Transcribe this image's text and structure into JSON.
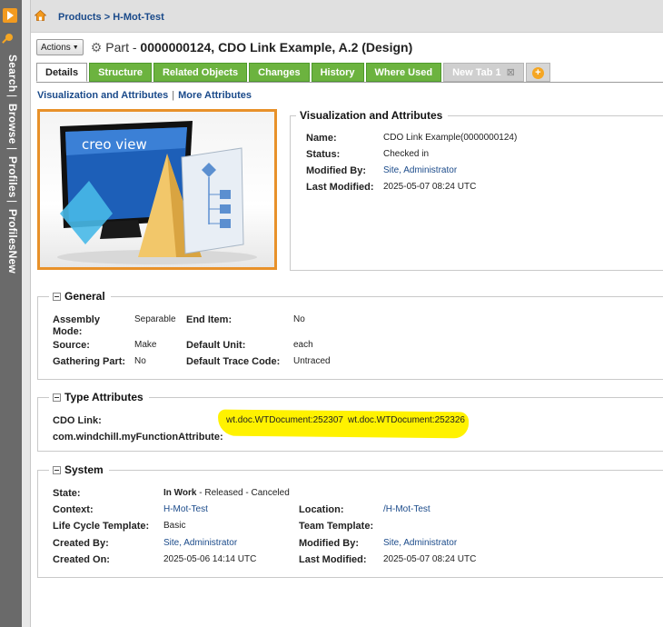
{
  "breadcrumb": "Products > H-Mot-Test",
  "left_nav": [
    "Search",
    "Browse",
    "Profiles",
    "ProfilesNew"
  ],
  "header": {
    "actions_label": "Actions",
    "object_type": "Part - ",
    "object_title": "0000000124, CDO Link Example, A.2 (Design)"
  },
  "tabs": [
    {
      "label": "Details",
      "active": true
    },
    {
      "label": "Structure"
    },
    {
      "label": "Related Objects"
    },
    {
      "label": "Changes"
    },
    {
      "label": "History"
    },
    {
      "label": "Where Used"
    },
    {
      "label": "New Tab 1"
    }
  ],
  "sublinks": {
    "visualization": "Visualization and Attributes",
    "more": "More Attributes"
  },
  "thumbnail": {
    "brand": "creo view"
  },
  "viz_attributes": {
    "title": "Visualization and Attributes",
    "name_label": "Name:",
    "name_value": "CDO Link Example(0000000124)",
    "status_label": "Status:",
    "status_value": "Checked in",
    "modified_by_label": "Modified By:",
    "modified_by_value": "Site, Administrator",
    "last_modified_label": "Last Modified:",
    "last_modified_value": "2025-05-07 08:24 UTC"
  },
  "general": {
    "title": "General",
    "assembly_mode_label": "Assembly Mode:",
    "assembly_mode_value": "Separable",
    "end_item_label": "End Item:",
    "end_item_value": "No",
    "source_label": "Source:",
    "source_value": "Make",
    "default_unit_label": "Default Unit:",
    "default_unit_value": "each",
    "gathering_part_label": "Gathering Part:",
    "gathering_part_value": "No",
    "default_trace_label": "Default Trace Code:",
    "default_trace_value": "Untraced"
  },
  "type_attributes": {
    "title": "Type Attributes",
    "cdo_link_label": "CDO Link:",
    "cdo_link_value_1": "wt.doc.WTDocument:252307",
    "cdo_link_value_2": "wt.doc.WTDocument:252326",
    "function_attr_label": "com.windchill.myFunctionAttribute:"
  },
  "system": {
    "title": "System",
    "state_label": "State:",
    "state_current": "In Work",
    "state_rest": " - Released - Canceled",
    "context_label": "Context:",
    "context_value": "H-Mot-Test",
    "location_label": "Location:",
    "location_value": "/H-Mot-Test",
    "lifecycle_label": "Life Cycle Template:",
    "lifecycle_value": "Basic",
    "team_label": "Team Template:",
    "created_by_label": "Created By:",
    "created_by_value": "Site, Administrator",
    "modified_by_label": "Modified By:",
    "modified_by_value": "Site, Administrator",
    "created_on_label": "Created On:",
    "created_on_value": "2025-05-06 14:14 UTC",
    "last_modified_label": "Last Modified:",
    "last_modified_value": "2025-05-07 08:24 UTC"
  },
  "colors": {
    "tab_green": "#6cb33f",
    "accent_orange": "#e8912a",
    "link_blue": "#1a4a8a",
    "highlight_yellow": "#fff200"
  }
}
